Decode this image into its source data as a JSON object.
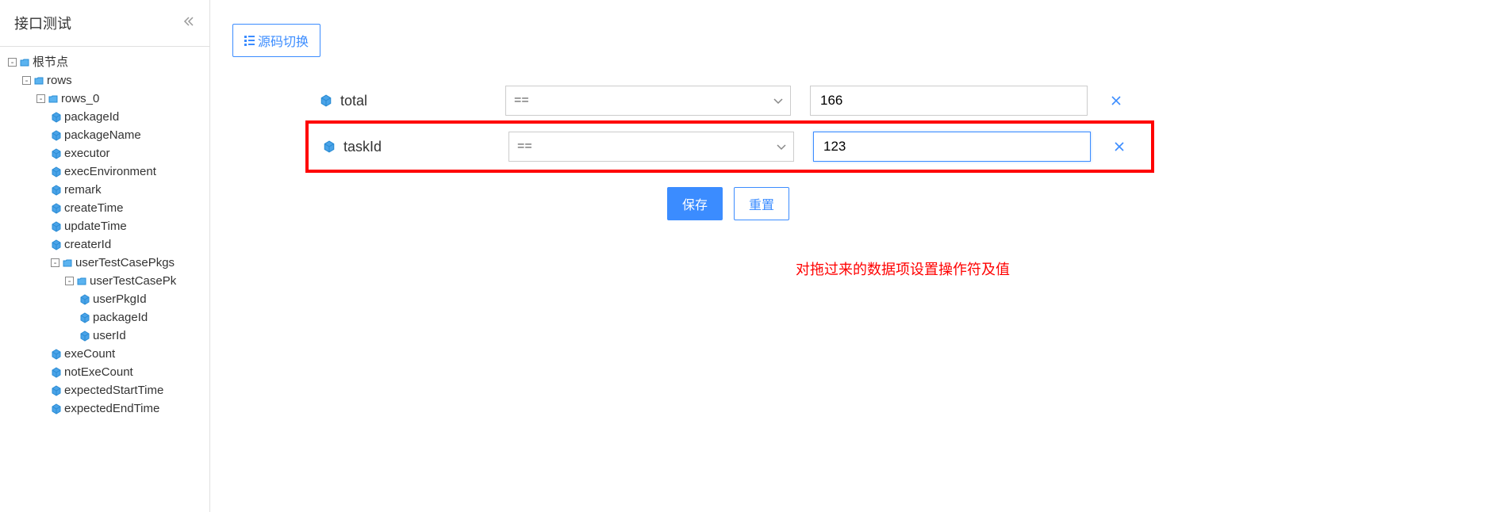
{
  "sidebar": {
    "title": "接口测试",
    "tree": {
      "root": "根节点",
      "rows": "rows",
      "rows_0": "rows_0",
      "fields": {
        "packageId": "packageId",
        "packageName": "packageName",
        "executor": "executor",
        "execEnvironment": "execEnvironment",
        "remark": "remark",
        "createTime": "createTime",
        "updateTime": "updateTime",
        "createrId": "createrId",
        "userTestCasePkgs": "userTestCasePkgs",
        "userTestCasePk": "userTestCasePk",
        "userPkgId": "userPkgId",
        "packageId2": "packageId",
        "userId": "userId",
        "exeCount": "exeCount",
        "notExeCount": "notExeCount",
        "expectedStartTime": "expectedStartTime",
        "expectedEndTime": "expectedEndTime"
      }
    }
  },
  "main": {
    "sourceToggle": "源码切换",
    "rules": [
      {
        "field": "total",
        "operator": "==",
        "value": "166"
      },
      {
        "field": "taskId",
        "operator": "==",
        "value": "123"
      }
    ],
    "saveLabel": "保存",
    "resetLabel": "重置",
    "annotation": "对拖过来的数据项设置操作符及值"
  }
}
